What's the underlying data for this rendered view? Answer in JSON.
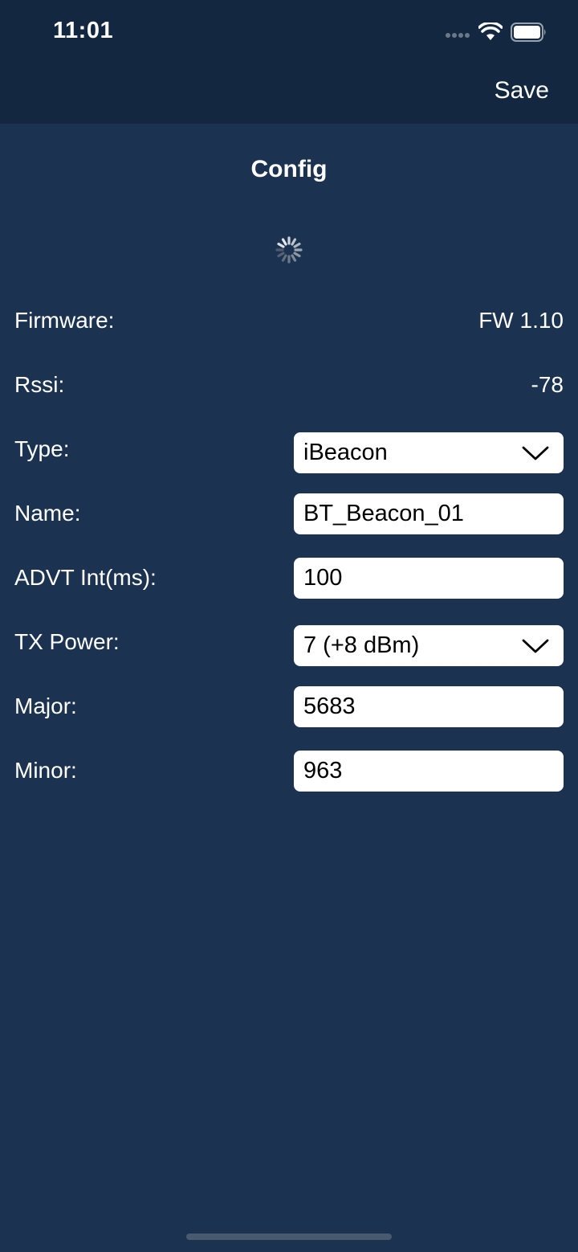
{
  "status_bar": {
    "time": "11:01"
  },
  "nav": {
    "save_label": "Save",
    "title": "Config"
  },
  "info": {
    "firmware_label": "Firmware:",
    "firmware_value": "FW 1.10",
    "rssi_label": "Rssi:",
    "rssi_value": "-78"
  },
  "form": {
    "type_label": "Type:",
    "type_value": "iBeacon",
    "name_label": "Name:",
    "name_value": "BT_Beacon_01",
    "advt_label": "ADVT Int(ms):",
    "advt_value": "100",
    "tx_label": "TX Power:",
    "tx_value": "7 (+8 dBm)",
    "major_label": "Major:",
    "major_value": "5683",
    "minor_label": "Minor:",
    "minor_value": "963"
  },
  "colors": {
    "background": "#1b3351",
    "topbar": "#132740",
    "field": "#ffffff"
  },
  "icons": [
    "signal-icon",
    "wifi-icon",
    "battery-icon",
    "spinner-icon",
    "chevron-down-icon"
  ]
}
